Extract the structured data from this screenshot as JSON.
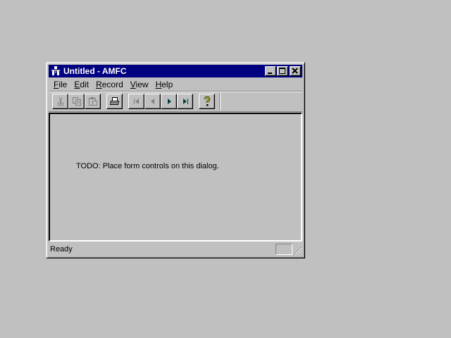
{
  "window": {
    "title": "Untitled - AMFC",
    "controls": [
      "minimize",
      "maximize",
      "close"
    ]
  },
  "menu": [
    {
      "label": "File",
      "key": "F",
      "rest": "ile"
    },
    {
      "label": "Edit",
      "key": "E",
      "rest": "dit"
    },
    {
      "label": "Record",
      "key": "R",
      "rest": "ecord"
    },
    {
      "label": "View",
      "key": "V",
      "rest": "iew"
    },
    {
      "label": "Help",
      "key": "H",
      "rest": "elp"
    }
  ],
  "toolbar": {
    "icons": [
      "cut-icon",
      "copy-icon",
      "paste-icon",
      "print-icon",
      "first-record-icon",
      "previous-record-icon",
      "next-record-icon",
      "last-record-icon",
      "help-icon"
    ]
  },
  "content": {
    "message": "TODO: Place form controls on this dialog."
  },
  "status": {
    "text": "Ready"
  },
  "colors": {
    "titlebar": "#000080",
    "face": "#c0c0c0",
    "accent_nav": "#008080"
  }
}
